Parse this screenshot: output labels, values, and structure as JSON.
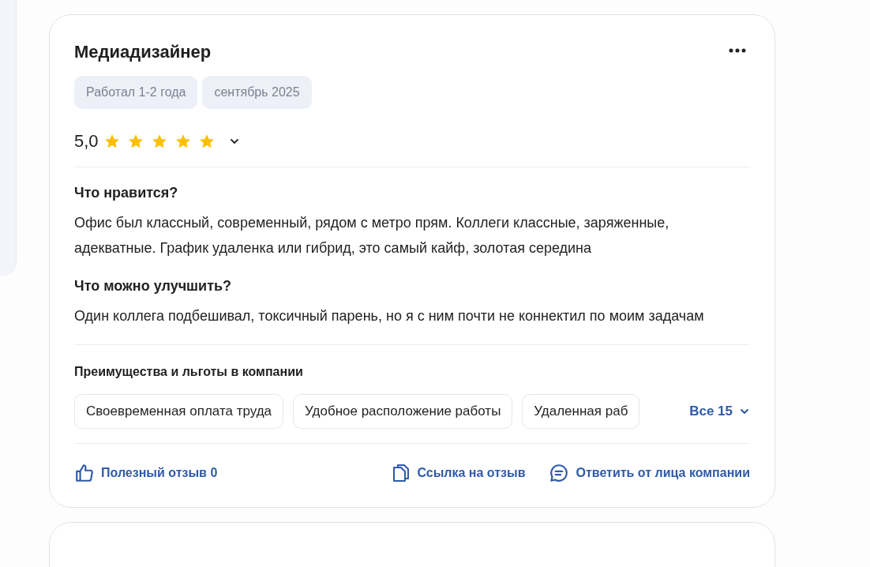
{
  "review": {
    "title": "Медиадизайнер",
    "tags": [
      "Работал 1-2 года",
      "сентябрь 2025"
    ],
    "rating": {
      "value": "5,0",
      "stars": 5,
      "expanded": false
    },
    "sections": [
      {
        "heading": "Что нравится?",
        "text": "Офис был классный, современный, рядом с метро прям. Коллеги классные, заряженные, адекватные. График удаленка или гибрид, это самый кайф, золотая середина"
      },
      {
        "heading": "Что можно улучшить?",
        "text": "Один коллега подбешивал, токсичный парень, но я с ним почти не коннектил по моим задачам"
      }
    ],
    "benefits": {
      "heading": "Преимущества и льготы в компании",
      "items": [
        "Своевременная оплата труда",
        "Удобное расположение работы",
        "Удаленная раб"
      ],
      "more": "Все 15"
    },
    "actions": [
      {
        "kind": "like",
        "label": "Полезный отзыв 0"
      },
      {
        "kind": "link",
        "label": "Ссылка на отзыв"
      },
      {
        "kind": "reply",
        "label": "Ответить от лица компании"
      }
    ]
  }
}
